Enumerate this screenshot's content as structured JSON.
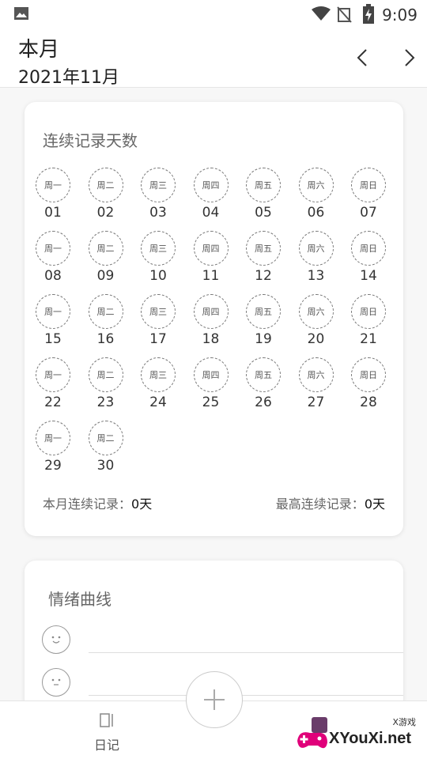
{
  "status_bar": {
    "time": "9:09"
  },
  "header": {
    "title": "本月",
    "subtitle": "2021年11月"
  },
  "streak_card": {
    "title": "连续记录天数",
    "days": [
      {
        "weekday": "周一",
        "date": "01"
      },
      {
        "weekday": "周二",
        "date": "02"
      },
      {
        "weekday": "周三",
        "date": "03"
      },
      {
        "weekday": "周四",
        "date": "04"
      },
      {
        "weekday": "周五",
        "date": "05"
      },
      {
        "weekday": "周六",
        "date": "06"
      },
      {
        "weekday": "周日",
        "date": "07"
      },
      {
        "weekday": "周一",
        "date": "08"
      },
      {
        "weekday": "周二",
        "date": "09"
      },
      {
        "weekday": "周三",
        "date": "10"
      },
      {
        "weekday": "周四",
        "date": "11"
      },
      {
        "weekday": "周五",
        "date": "12"
      },
      {
        "weekday": "周六",
        "date": "13"
      },
      {
        "weekday": "周日",
        "date": "14"
      },
      {
        "weekday": "周一",
        "date": "15"
      },
      {
        "weekday": "周二",
        "date": "16"
      },
      {
        "weekday": "周三",
        "date": "17"
      },
      {
        "weekday": "周四",
        "date": "18"
      },
      {
        "weekday": "周五",
        "date": "19"
      },
      {
        "weekday": "周六",
        "date": "20"
      },
      {
        "weekday": "周日",
        "date": "21"
      },
      {
        "weekday": "周一",
        "date": "22"
      },
      {
        "weekday": "周二",
        "date": "23"
      },
      {
        "weekday": "周三",
        "date": "24"
      },
      {
        "weekday": "周四",
        "date": "25"
      },
      {
        "weekday": "周五",
        "date": "26"
      },
      {
        "weekday": "周六",
        "date": "27"
      },
      {
        "weekday": "周日",
        "date": "28"
      },
      {
        "weekday": "周一",
        "date": "29"
      },
      {
        "weekday": "周二",
        "date": "30"
      }
    ],
    "month_streak_label": "本月连续记录：",
    "month_streak_value": "0天",
    "best_streak_label": "最高连续记录：",
    "best_streak_value": "0天"
  },
  "mood_card": {
    "title": "情绪曲线"
  },
  "bottom_nav": {
    "diary_label": "日记"
  },
  "watermark": {
    "text": "XYouXi.net",
    "small": "X游戏"
  },
  "colors": {
    "accent": "#222222",
    "dashed": "#777777"
  }
}
